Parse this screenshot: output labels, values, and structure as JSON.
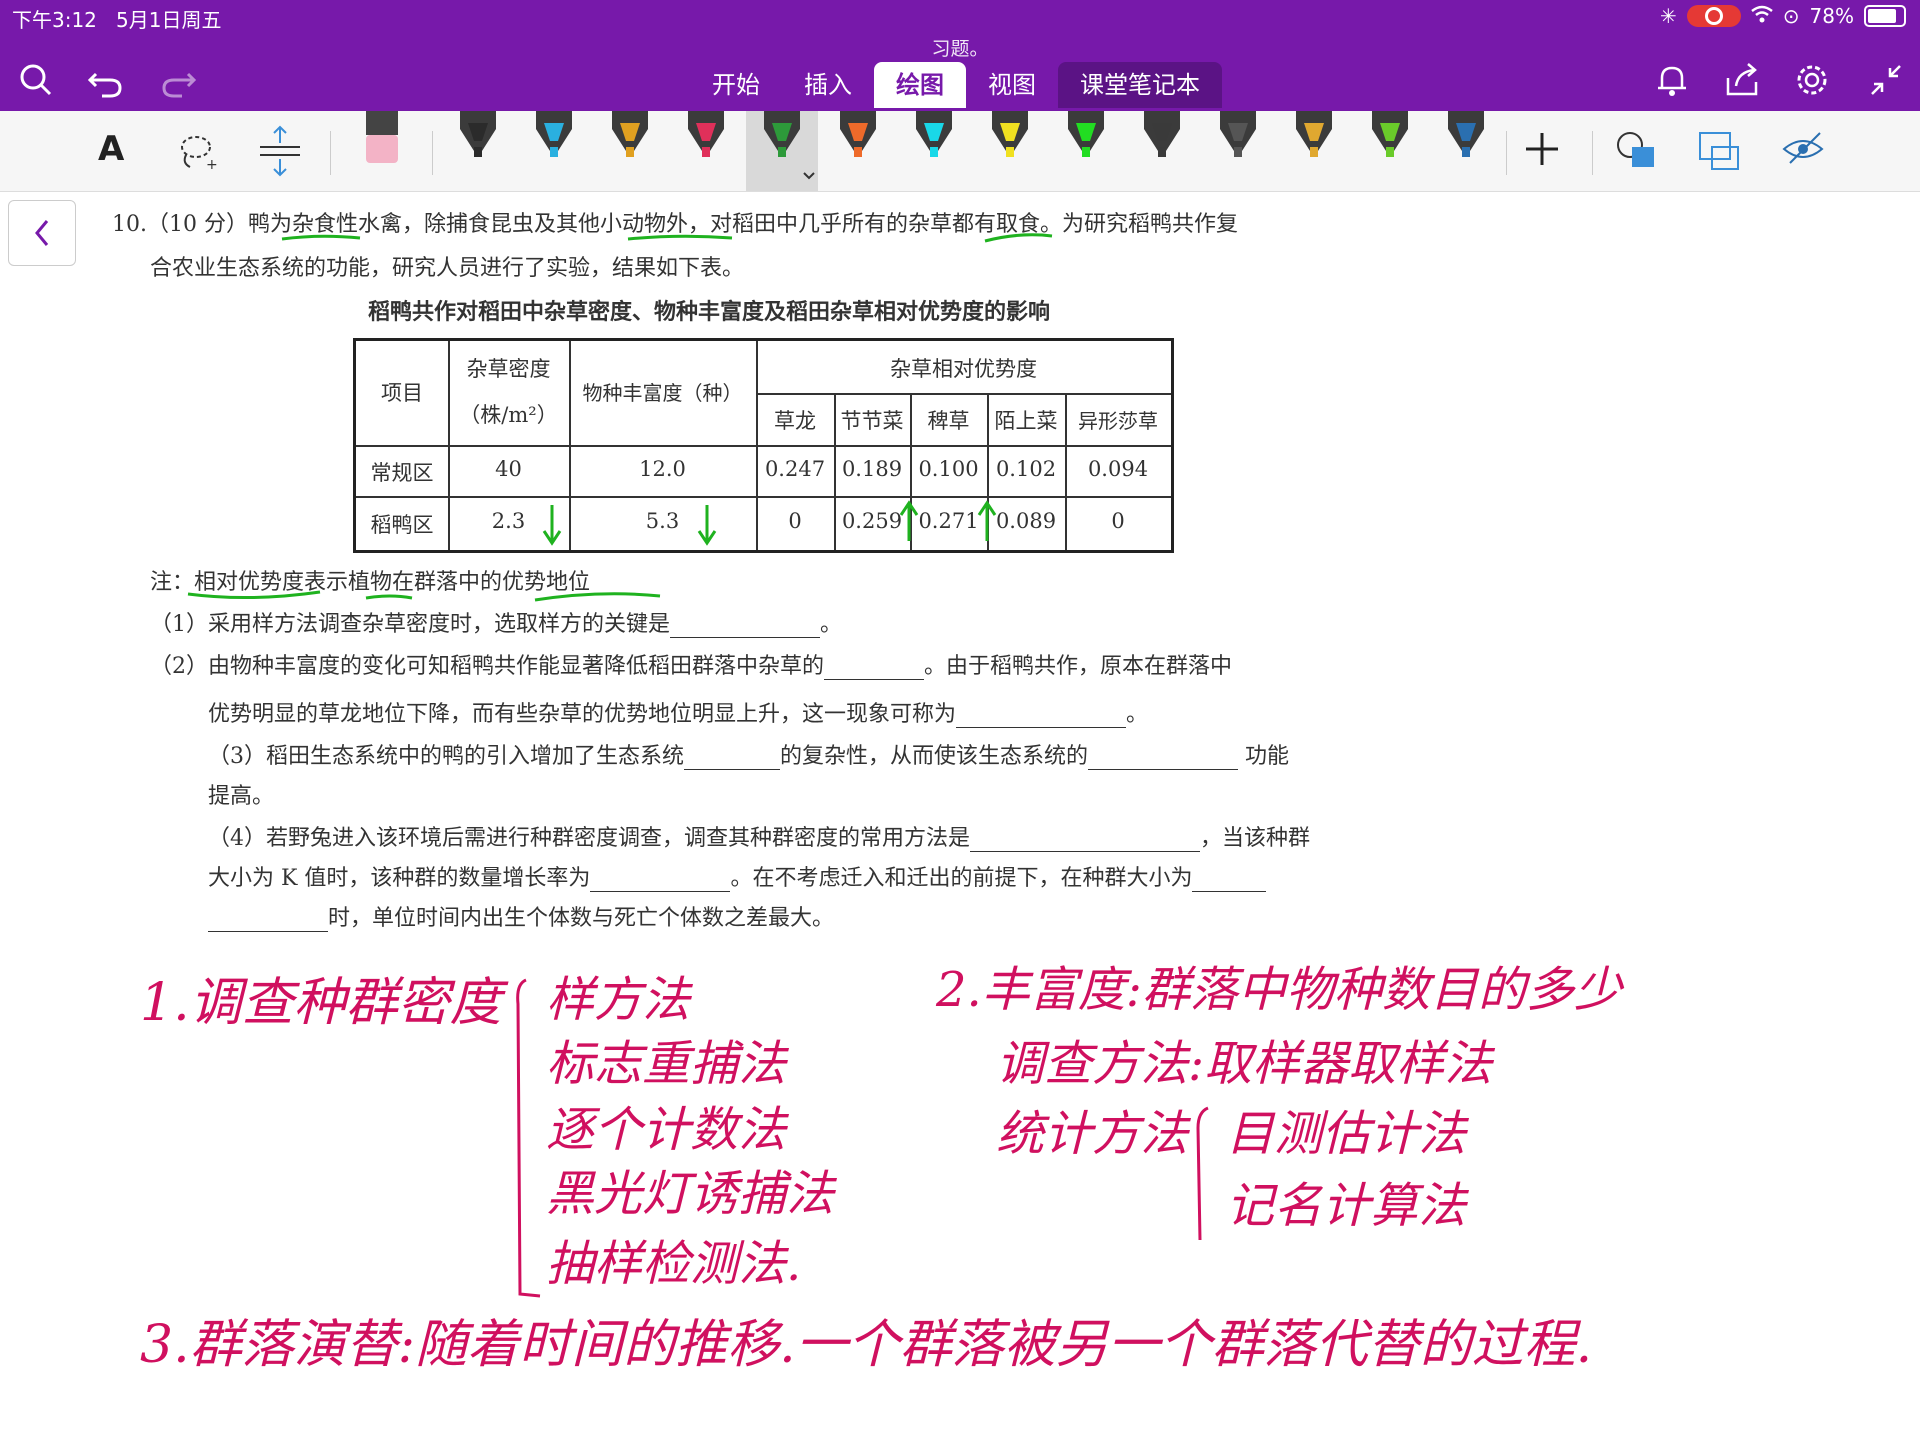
{
  "status": {
    "time": "下午3:12",
    "date": "5月1日周五",
    "battery": "78%"
  },
  "app": {
    "doc_title": "习题。",
    "tabs": [
      "开始",
      "插入",
      "绘图",
      "视图"
    ],
    "section": "课堂笔记本",
    "active_tab": "绘图"
  },
  "toolbar": {
    "text_tool": "A",
    "pens": [
      {
        "color": "#2b2b2b"
      },
      {
        "color": "#2ab0e0"
      },
      {
        "color": "#e0a020"
      },
      {
        "color": "#e0305a"
      },
      {
        "color": "#2d9a3a"
      },
      {
        "color": "#ee6a2a"
      },
      {
        "color": "#19d8e8"
      },
      {
        "color": "#f0e020"
      },
      {
        "color": "#22dd22"
      },
      {
        "color": "#3a3a3a"
      },
      {
        "color": "#555555"
      },
      {
        "color": "#e0a830"
      },
      {
        "color": "#6acb2a"
      },
      {
        "color": "#2a6fb0"
      }
    ],
    "accent": "#7719AA"
  },
  "question": {
    "line1": "10.（10 分）鸭为杂食性水禽，除捕食昆虫及其他小动物外，对稻田中几乎所有的杂草都有取食。为研究稻鸭共作复",
    "line2": "合农业生态系统的功能，研究人员进行了实验，结果如下表。",
    "table_title": "稻鸭共作对稻田中杂草密度、物种丰富度及稻田杂草相对优势度的影响",
    "table": {
      "h_item": "项目",
      "h_density_1": "杂草密度",
      "h_density_2": "（株/m²）",
      "h_richness": "物种丰富度（种）",
      "h_dominance": "杂草相对优势度",
      "species": [
        "草龙",
        "节节菜",
        "稗草",
        "陌上菜",
        "异形莎草"
      ],
      "rows": [
        {
          "name": "常规区",
          "density": "40",
          "richness": "12.0",
          "vals": [
            "0.247",
            "0.189",
            "0.100",
            "0.102",
            "0.094"
          ]
        },
        {
          "name": "稻鸭区",
          "density": "2.3",
          "richness": "5.3",
          "vals": [
            "0",
            "0.259",
            "0.271",
            "0.089",
            "0"
          ]
        }
      ]
    },
    "note": "注：相对优势度表示植物在群落中的优势地位",
    "q1": "（1）采用样方法调查杂草密度时，选取样方的关键是",
    "q1_end": "。",
    "q2a": "（2）由物种丰富度的变化可知稻鸭共作能显著降低稻田群落中杂草的",
    "q2b": "。由于稻鸭共作，原本在群落中",
    "q2c": "优势明显的草龙地位下降，而有些杂草的优势地位明显上升，这一现象可称为",
    "q2_end": "。",
    "q3a": "（3）稻田生态系统中的鸭的引入增加了生态系统",
    "q3b": "的复杂性，从而使该生态系统的",
    "q3c": "功能",
    "q3d": "提高。",
    "q4a": "（4）若野兔进入该环境后需进行种群密度调查，调查其种群密度的常用方法是",
    "q4b": "，当该种群",
    "q4c": "大小为 K 值时，该种群的数量增长率为",
    "q4d": "。在不考虑迁入和迁出的前提下，在种群大小为",
    "q4e": "时，单位时间内出生个体数与死亡个体数之差最大。"
  },
  "notes": {
    "n1_title": "1.调查种群密度",
    "n1_items": [
      "样方法",
      "标志重捕法",
      "逐个计数法",
      "黑光灯诱捕法",
      "抽样检测法."
    ],
    "n2_title": "2.丰富度:群落中物种数目的多少",
    "n2_method": "调查方法:取样器取样法",
    "n2_stat": "统计方法",
    "n2_items": [
      "目测估计法",
      "记名计算法"
    ],
    "n3": "3.群落演替:随着时间的推移.一个群落被另一个群落代替的过程.",
    "ink_color": "#d0105f",
    "highlight_color": "#1fb21f"
  }
}
